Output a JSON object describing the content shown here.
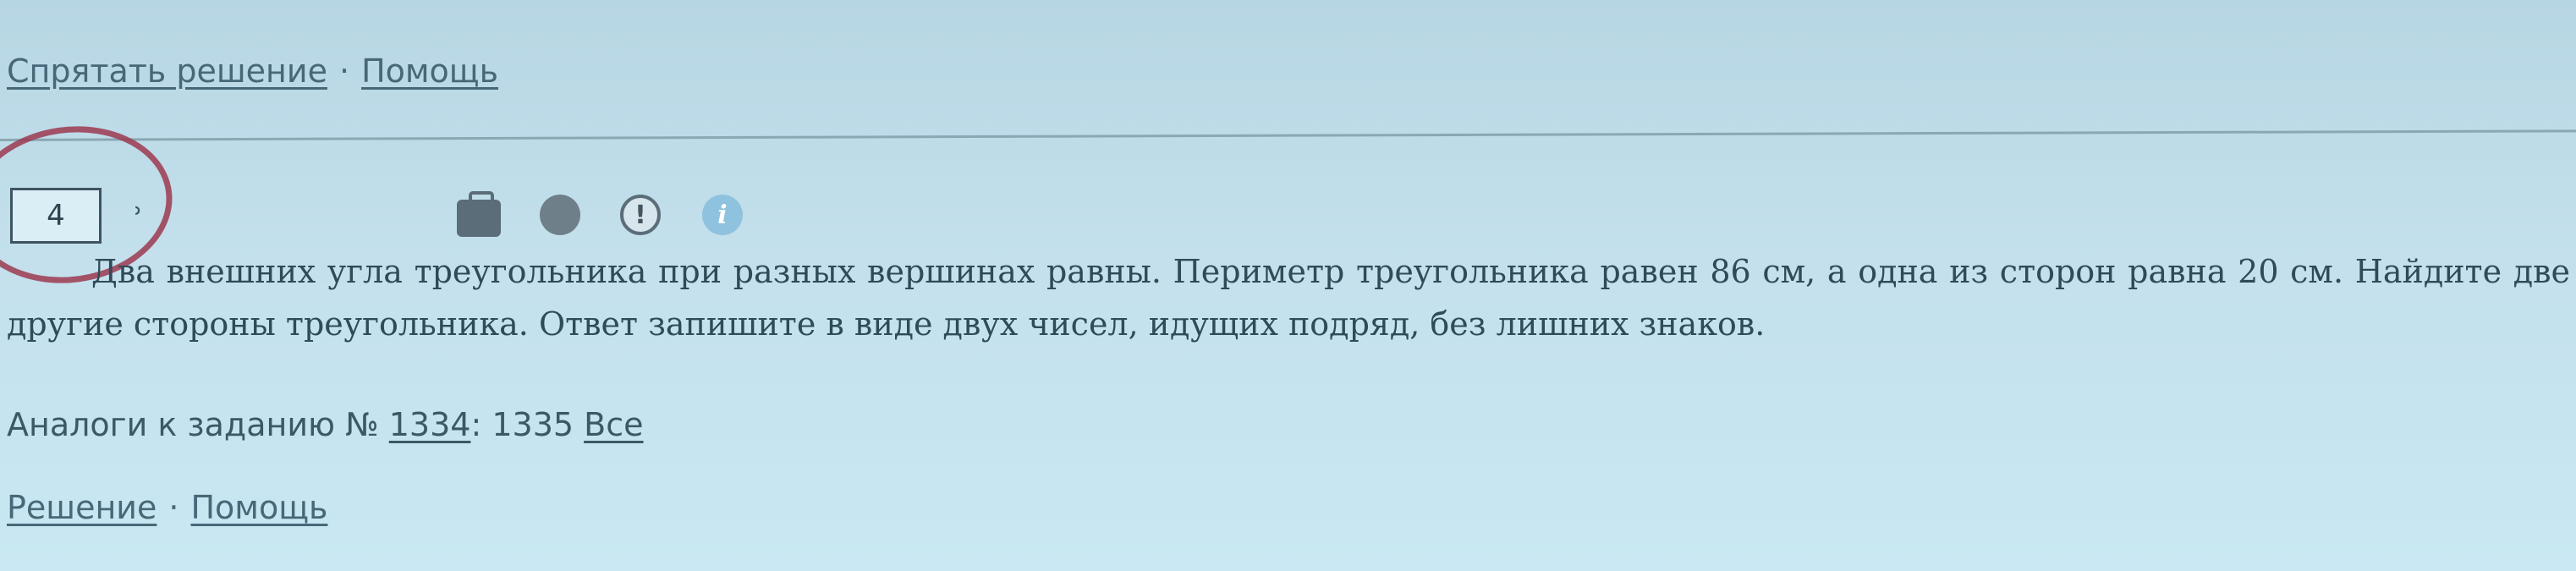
{
  "top_links": {
    "hide_solution": "Спрятать решение",
    "separator": "·",
    "help": "Помощь"
  },
  "task": {
    "number": "4",
    "text": "Два внешних угла треугольника при разных вершинах равны. Периметр треугольника равен 86 см, а одна из сторон равна 20 см. Найдите две другие стороны треугольника. Ответ запишите в виде двух чисел, идущих подряд, без лишних знаков.",
    "toolbar_icons": [
      "briefcase-icon",
      "dot-icon",
      "warning-icon",
      "info-icon"
    ],
    "info_glyph": "i",
    "warning_glyph": "!"
  },
  "analogs": {
    "label": "Аналоги к заданию №",
    "first_link": "1334",
    "colon": ":",
    "second": "1335",
    "all_link": "Все"
  },
  "bottom_links": {
    "solution": "Решение",
    "separator": "·",
    "help": "Помощь"
  },
  "colors": {
    "background": "#c3e0ec",
    "text": "#2f4a58",
    "circle_annotation": "#9c3a50"
  }
}
